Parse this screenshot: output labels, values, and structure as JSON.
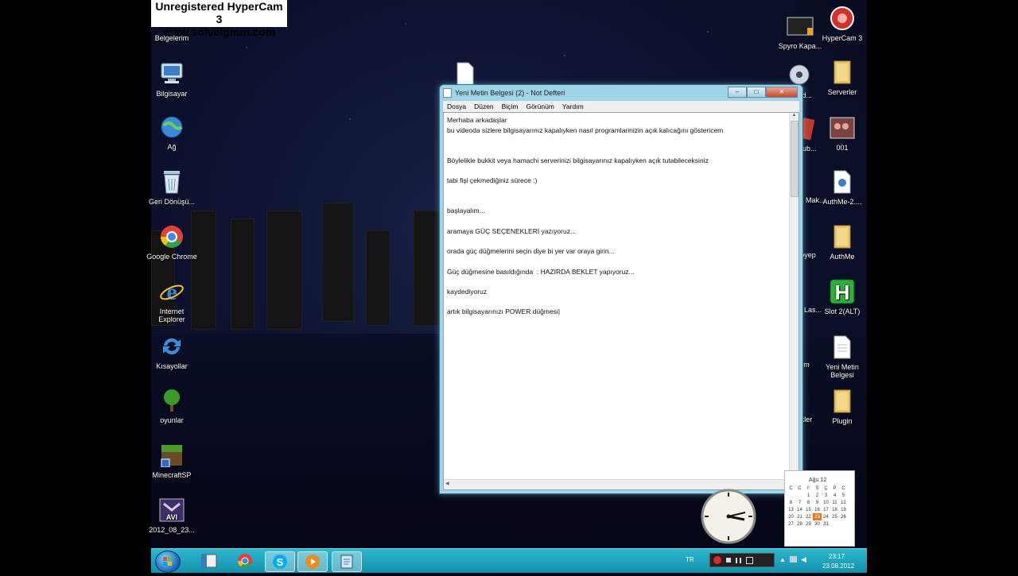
{
  "watermark": {
    "line1": "Unregistered HyperCam 3",
    "line2": "www.solveigmm.com"
  },
  "desktop_left_icons": [
    {
      "label": "Belgelerim",
      "icon": "documents-folder-icon"
    },
    {
      "label": "Bilgisayar",
      "icon": "computer-icon"
    },
    {
      "label": "Ağ",
      "icon": "network-icon"
    },
    {
      "label": "Geri Dönüşü...",
      "icon": "recycle-bin-icon"
    },
    {
      "label": "Google Chrome",
      "icon": "chrome-icon"
    },
    {
      "label": "Internet Explorer",
      "icon": "internet-explorer-icon"
    },
    {
      "label": "Kısayollar",
      "icon": "shortcuts-icon"
    },
    {
      "label": "oyunlar",
      "icon": "tree-icon"
    },
    {
      "label": "MinecraftSP",
      "icon": "minecraft-icon"
    },
    {
      "label": "2012_08_23...",
      "icon": "avi-file-icon"
    }
  ],
  "desktop_mid_icons": [
    {
      "label": "Spyro Kapa...",
      "icon": "video-file-icon"
    },
    {
      "label": "nd ud...",
      "icon": "media-icon"
    },
    {
      "label": "e ub...",
      "icon": "app-icon"
    },
    {
      "label": "ows Mak...",
      "icon": "app-icon"
    },
    {
      "label": "oyep",
      "icon": "app-icon"
    },
    {
      "label": "ns Las...",
      "icon": "app-icon"
    },
    {
      "label": "m",
      "icon": "app-icon"
    },
    {
      "label": "kler",
      "icon": "app-icon"
    }
  ],
  "desktop_right_icons": [
    {
      "label": "HyperCam 3",
      "icon": "hypercam-icon"
    },
    {
      "label": "Serverler",
      "icon": "folder-icon"
    },
    {
      "label": "001",
      "icon": "image-file-icon"
    },
    {
      "label": "AuthMe-2....",
      "icon": "java-file-icon"
    },
    {
      "label": "AuthMe",
      "icon": "folder-icon"
    },
    {
      "label": "Slot 2(ALT)",
      "icon": "h-app-icon"
    },
    {
      "label": "Yeni Metin Belgesi",
      "icon": "text-file-icon"
    },
    {
      "label": "Plugin",
      "icon": "folder-icon"
    }
  ],
  "notepad": {
    "title": "Yeni Metin Belgesi (2) - Not Defteri",
    "menu": [
      "Dosya",
      "Düzen",
      "Biçim",
      "Görünüm",
      "Yardım"
    ],
    "minimize": "–",
    "maximize": "□",
    "close": "✕",
    "content": "Merhaba arkadaşlar\nbu videoda sizlere bilgisayarınız kapalıyken nasıl programlarinizin açık kalıcağını göstericem\n\n\nBöylelikle bukkit veya hamachi serverinizi bilgisayarınız kapalıyken açık tutabileceksiniz\n\ntabi fişi çekmediğiniz sürece :)\n\n\nbaşlayalım...\n\naramaya GÜÇ SEÇENEKLERİ yazıyoruz...\n\norada güç düğmelerini seçin diye bi yer var oraya girin...\n\nGüç düğmesine basıldığında  : HAZIRDA BEKLET yapıyoruz...\n\nkaydediyoruz\n\nartık bilgisayarınızı POWER düğmesi|"
  },
  "taskbar": {
    "language": "TR",
    "time": "23:17",
    "date": "23.08.2012"
  },
  "calendar": {
    "header": "Ağu 12",
    "weekdays": [
      "C",
      "C",
      "P",
      "S",
      "Ç",
      "P",
      "C"
    ],
    "rows": [
      [
        "",
        "",
        "1",
        "2",
        "3",
        "4",
        "5"
      ],
      [
        "6",
        "7",
        "8",
        "9",
        "10",
        "11",
        "12"
      ],
      [
        "13",
        "14",
        "15",
        "16",
        "17",
        "18",
        "19"
      ],
      [
        "20",
        "21",
        "22",
        "23",
        "24",
        "25",
        "26"
      ],
      [
        "27",
        "28",
        "29",
        "30",
        "31",
        "",
        ""
      ]
    ],
    "today": "23"
  }
}
